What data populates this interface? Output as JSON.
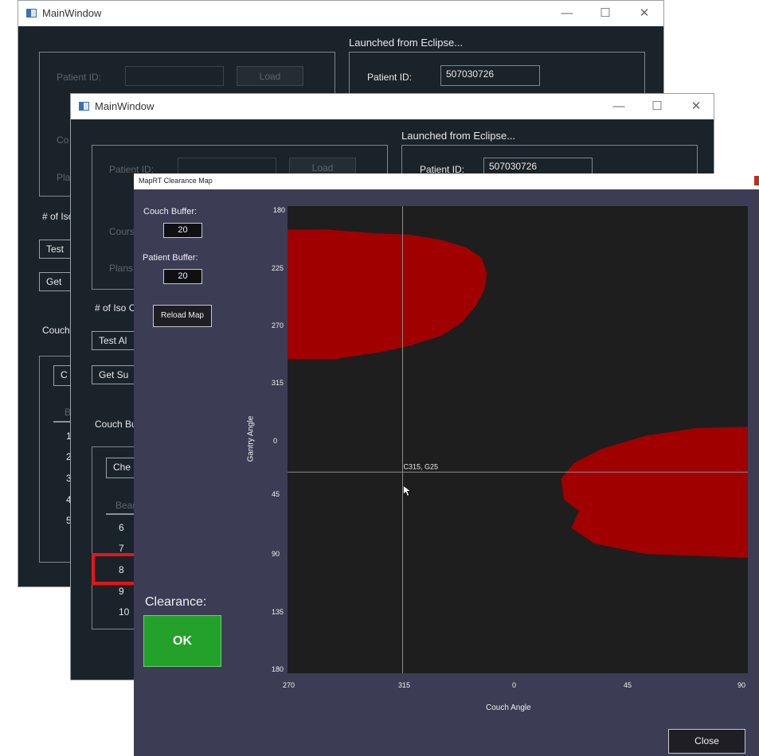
{
  "back_window": {
    "title": "MainWindow",
    "header": "Launched from Eclipse...",
    "patient_id_label": "Patient ID:",
    "patient_id_value": "507030726",
    "load_label": "Load",
    "iso_label": "# of Iso",
    "test_label": "Test",
    "get_label": "Get",
    "couch_label": "Couch",
    "check_label": "C",
    "beam_header": "Be",
    "beam_rows": [
      "1",
      "2",
      "3",
      "4",
      "5"
    ],
    "course_label": "Co",
    "plans_label": "Pla"
  },
  "front_window": {
    "title": "MainWindow",
    "header": "Launched from Eclipse...",
    "patient_id_label": "Patient ID:",
    "patient_id_value": "507030726",
    "load_label": "Load",
    "courses_label": "Cours",
    "plans_label": "Plans:",
    "iso_label": "# of Iso C",
    "test_label": "Test Al",
    "get_label": "Get Su",
    "couch_buffer_label": "Couch Bu",
    "check_label": "Che",
    "beam_header": "Bear",
    "beam_rows": [
      "6",
      "7",
      "8",
      "9",
      "10"
    ]
  },
  "window_controls": {
    "minimize": "—",
    "maximize": "☐",
    "close": "✕"
  },
  "dialog": {
    "title": "MapRT Clearance Map",
    "couch_buffer_label": "Couch Buffer:",
    "couch_buffer_value": "20",
    "patient_buffer_label": "Patient Buffer:",
    "patient_buffer_value": "20",
    "reload_label": "Reload Map",
    "clearance_label": "Clearance:",
    "clearance_status": "OK",
    "close_label": "Close",
    "cursor_readout": "C315, G25",
    "cursor_icon": "mouse-pointer-icon"
  },
  "chart_data": {
    "type": "heatmap",
    "xlabel": "Couch Angle",
    "ylabel": "Gantry Angle",
    "x_ticks": [
      "270",
      "315",
      "0",
      "45",
      "90"
    ],
    "y_ticks": [
      "180",
      "225",
      "270",
      "315",
      "0",
      "45",
      "90",
      "135",
      "180"
    ],
    "x_range_deg": [
      270,
      450
    ],
    "y_range_deg": [
      180,
      540
    ],
    "crosshair": {
      "couch": 315,
      "gantry": 25
    },
    "collision_color": "#a00000",
    "clear_color": "#1e1e1e",
    "collision_regions": [
      {
        "name": "upper-left",
        "outline": [
          [
            270,
            198
          ],
          [
            285,
            198
          ],
          [
            305,
            201
          ],
          [
            318,
            202
          ],
          [
            330,
            206
          ],
          [
            340,
            212
          ],
          [
            346,
            220
          ],
          [
            348,
            232
          ],
          [
            347,
            244
          ],
          [
            344,
            256
          ],
          [
            338,
            270
          ],
          [
            330,
            280
          ],
          [
            317,
            288
          ],
          [
            305,
            293
          ],
          [
            288,
            298
          ],
          [
            270,
            298
          ]
        ]
      },
      {
        "name": "lower-right",
        "outline": [
          [
            450,
            350
          ],
          [
            430,
            351
          ],
          [
            410,
            357
          ],
          [
            393,
            367
          ],
          [
            382,
            378
          ],
          [
            377,
            390
          ],
          [
            378,
            406
          ],
          [
            384,
            415
          ],
          [
            381,
            428
          ],
          [
            390,
            440
          ],
          [
            410,
            448
          ],
          [
            450,
            451
          ]
        ]
      }
    ]
  }
}
